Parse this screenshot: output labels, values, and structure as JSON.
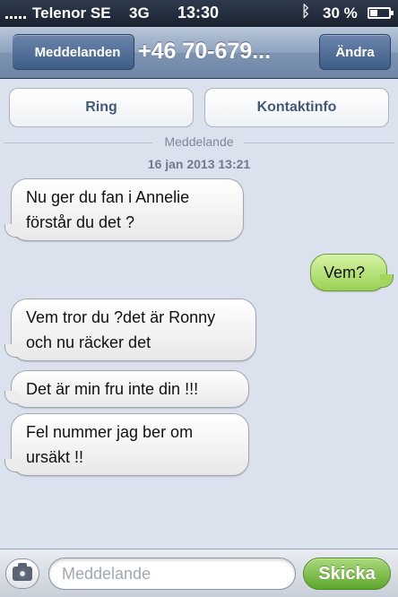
{
  "status_bar": {
    "carrier": "Telenor SE",
    "network": "3G",
    "time": "13:30",
    "battery_percent": "30 %",
    "bluetooth_icon": "bluetooth-icon"
  },
  "nav": {
    "back_label": "Meddelanden",
    "title": "+46 70-679...",
    "edit_label": "Ändra"
  },
  "actions": {
    "call_label": "Ring",
    "contact_info_label": "Kontaktinfo"
  },
  "thread": {
    "divider_label": "Meddelande",
    "timestamp": "16 jan 2013 13:21",
    "messages": [
      {
        "direction": "incoming",
        "text": "Nu ger du fan i Annelie förstår du det ?"
      },
      {
        "direction": "outgoing",
        "text": "Vem?"
      },
      {
        "direction": "incoming",
        "text": "Vem tror du ?det är Ronny och nu räcker det"
      },
      {
        "direction": "incoming",
        "text": "Det är min fru inte din !!!"
      },
      {
        "direction": "incoming",
        "text": "Fel nummer jag ber om ursäkt !!"
      }
    ]
  },
  "composer": {
    "placeholder": "Meddelande",
    "value": "",
    "send_label": "Skicka",
    "camera_icon": "camera-icon"
  },
  "colors": {
    "outgoing_bubble": "#9ad154",
    "incoming_bubble": "#ffffff",
    "nav_accent": "#3f5d88",
    "send_button": "#5ea72c",
    "background": "#dbe2ed"
  }
}
